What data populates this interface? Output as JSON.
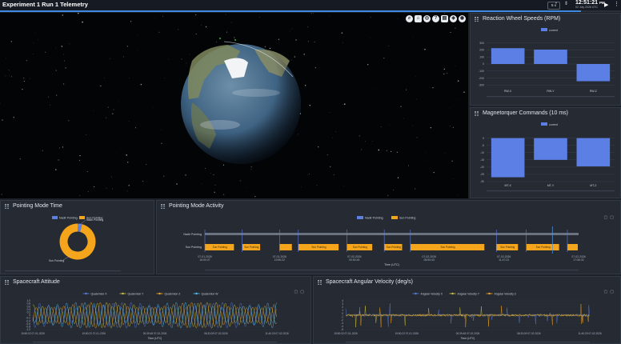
{
  "app": {
    "title": "Experiment 1 Run 1 Telemetry"
  },
  "topbar": {
    "speed": "5 x",
    "clock_time": "12:51:21",
    "clock_unit": "PM",
    "clock_date": "02 July 2026 UTC",
    "timeline_progress": 0.935
  },
  "globe_toolbar": {
    "icons": [
      "search-icon",
      "home-icon",
      "globe-icon",
      "help-icon",
      "layers-icon",
      "compass-icon",
      "camera-icon"
    ]
  },
  "reaction_wheel": {
    "title": "Reaction Wheel Speeds (RPM)",
    "chart_data": {
      "type": "bar",
      "legend": [
        "current"
      ],
      "categories": [
        "RW-X",
        "RW-Y",
        "RW-Z"
      ],
      "values": [
        225,
        205,
        -245
      ],
      "ylim": [
        -330,
        330
      ],
      "yticks": [
        300,
        200,
        100,
        0,
        -100,
        -200,
        -300
      ],
      "color": "#5b7fe4"
    }
  },
  "magnetorquer": {
    "title": "Magnetorquer Commands (10 ms)",
    "chart_data": {
      "type": "bar",
      "legend": [
        "current"
      ],
      "categories": [
        "MT-X",
        "MT-Y",
        "MT-Z"
      ],
      "values": [
        -27,
        -15,
        -19.5
      ],
      "ylim": [
        -30,
        2
      ],
      "yticks": [
        0,
        -5,
        -10,
        -15,
        -20,
        -25,
        -30
      ],
      "color": "#5b7fe4"
    }
  },
  "pointing_time": {
    "title": "Pointing Mode Time",
    "chart_data": {
      "type": "pie",
      "legend": [
        "Nadir Pointing",
        "Sun Pointing"
      ],
      "values": [
        4,
        96
      ],
      "colors": [
        "#5b7fe4",
        "#f5a51c"
      ],
      "slice_label": "Sun Pointing",
      "callout_label": "Nadir Pointing"
    }
  },
  "pointing_activity": {
    "title": "Pointing Mode Activity",
    "chart_data": {
      "type": "bar",
      "legend": [
        "Nadir Pointing",
        "Sun Pointing"
      ],
      "rows": [
        "Nadir Pointing",
        "Sun Pointing"
      ],
      "xlabel": "Time (UTC)",
      "ticks": [
        {
          "d": "07-01-2026",
          "t": "16:50:07"
        },
        {
          "d": "07-01-2026",
          "t": "19:50:22"
        },
        {
          "d": "07-02-2026",
          "t": "00:50:45"
        },
        {
          "d": "07-02-2026",
          "t": "05:50:43"
        },
        {
          "d": "07-02-2026",
          "t": "11:47:23"
        },
        {
          "d": "07-02-2026",
          "t": "17:56:32"
        }
      ],
      "segments": [
        [
          0,
          0.08
        ],
        [
          0.1,
          0.15
        ],
        [
          0.2,
          0.235
        ],
        [
          0.25,
          0.36
        ],
        [
          0.38,
          0.45
        ],
        [
          0.48,
          0.53
        ],
        [
          0.55,
          0.75
        ],
        [
          0.78,
          0.84
        ],
        [
          0.86,
          0.95
        ],
        [
          0.97,
          1.0
        ]
      ],
      "colors": [
        "#5b7fe4",
        "#f5a51c"
      ],
      "segment_label": "Sun Pointing"
    }
  },
  "attitude": {
    "title": "Spacecraft Attitude",
    "chart_data": {
      "type": "line",
      "legend": [
        "Quaternion X",
        "Quaternion Y",
        "Quaternion Z",
        "Quaternion W"
      ],
      "colors": [
        "#5b7fe4",
        "#d4c73a",
        "#f5a51c",
        "#4fc3f7"
      ],
      "ylim": [
        -1,
        1
      ],
      "yticks": [
        "1.0",
        "0.8",
        "0.6",
        "0.4",
        "0.2",
        "0",
        "-0.2",
        "-0.4",
        "-0.6",
        "-0.8",
        "-1.0"
      ],
      "xticks": [
        "15:50:02 07-01-2026",
        "19:50:22 07-01-2026",
        "00:39:48 07-02-2026",
        "06:33:09 07-02-2026",
        "11:40:25 07-02-2026"
      ],
      "xlabel": "Time (UTC)"
    }
  },
  "angular_velocity": {
    "title": "Spacecraft Angular Velocity (deg/s)",
    "chart_data": {
      "type": "line",
      "legend": [
        "Angular Velocity X",
        "Angular Velocity Y",
        "Angular Velocity Z"
      ],
      "colors": [
        "#5b7fe4",
        "#d4c73a",
        "#f5a51c"
      ],
      "ylim": [
        -5,
        5
      ],
      "yticks": [
        "4",
        "3",
        "2",
        "1",
        "0",
        "-1",
        "-2",
        "-3",
        "-4",
        "-5"
      ],
      "xticks": [
        "15:50:02 07-01-2026",
        "19:50:22 07-01-2026",
        "00:39:48 07-02-2026",
        "06:33:09 07-02-2026",
        "11:40:25 07-02-2026"
      ],
      "xlabel": "Time (UTC)"
    }
  }
}
